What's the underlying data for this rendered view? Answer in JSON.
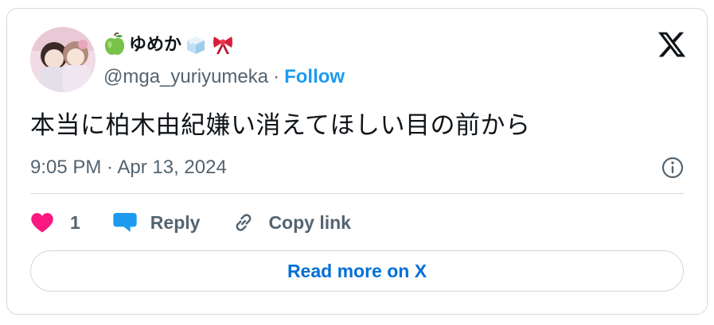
{
  "author": {
    "display_name": "ゆめか",
    "name_emojis": [
      "green-apple-icon",
      "ice-cube-icon",
      "ribbon-icon"
    ],
    "handle": "@mga_yuriyumeka",
    "separator": "·",
    "follow_label": "Follow"
  },
  "tweet": {
    "text": "本当に柏木由紀嫌い消えてほしい目の前から",
    "timestamp": "9:05 PM · Apr 13, 2024"
  },
  "actions": {
    "like_count": "1",
    "reply_label": "Reply",
    "copy_link_label": "Copy link"
  },
  "read_more_label": "Read more on X",
  "colors": {
    "accent": "#1d9bf0",
    "link": "#006fd6",
    "like": "#f91880",
    "muted": "#536471",
    "border": "#cfd9de"
  }
}
